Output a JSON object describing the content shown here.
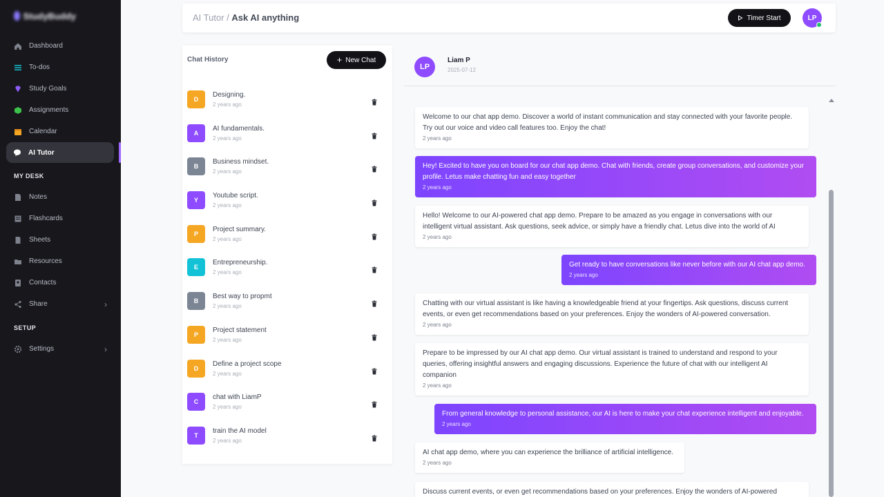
{
  "sidebar": {
    "logo_text": "StudyBuddy",
    "nav": [
      {
        "label": "Dashboard",
        "icon": "home-icon"
      },
      {
        "label": "To-dos",
        "icon": "list-icon"
      },
      {
        "label": "Study Goals",
        "icon": "diamond-icon"
      },
      {
        "label": "Assignments",
        "icon": "cube-icon"
      },
      {
        "label": "Calendar",
        "icon": "calendar-icon"
      },
      {
        "label": "AI Tutor",
        "icon": "chat-bubble-icon"
      }
    ],
    "my_desk_title": "MY DESK",
    "desk": [
      {
        "label": "Notes",
        "icon": "note-icon"
      },
      {
        "label": "Flashcards",
        "icon": "cards-icon"
      },
      {
        "label": "Sheets",
        "icon": "sheet-icon"
      },
      {
        "label": "Resources",
        "icon": "folder-icon"
      },
      {
        "label": "Contacts",
        "icon": "contacts-icon"
      },
      {
        "label": "Share",
        "icon": "share-icon"
      }
    ],
    "setup_title": "SETUP",
    "setup": [
      {
        "label": "Settings",
        "icon": "gear-icon"
      }
    ]
  },
  "header": {
    "crumb_parent": "AI Tutor",
    "crumb_sep": " / ",
    "crumb_current": "Ask AI anything",
    "timer_label": "Timer Start",
    "avatar_initials": "LP"
  },
  "history": {
    "title": "Chat History",
    "new_chat_label": "New Chat",
    "items": [
      {
        "letter": "D",
        "title": "Designing.",
        "time": "2 years ago",
        "color": "#f5a623"
      },
      {
        "letter": "A",
        "title": "AI fundamentals.",
        "time": "2 years ago",
        "color": "#8e4bff"
      },
      {
        "letter": "B",
        "title": "Business mindset.",
        "time": "2 years ago",
        "color": "#7c8594"
      },
      {
        "letter": "Y",
        "title": "Youtube script.",
        "time": "2 years ago",
        "color": "#8e4bff"
      },
      {
        "letter": "P",
        "title": "Project summary.",
        "time": "2 years ago",
        "color": "#f5a623"
      },
      {
        "letter": "E",
        "title": "Entrepreneurship.",
        "time": "2 years ago",
        "color": "#13c2d6"
      },
      {
        "letter": "B",
        "title": "Best way to propmt",
        "time": "2 years ago",
        "color": "#7c8594"
      },
      {
        "letter": "P",
        "title": "Project statement",
        "time": "2 years ago",
        "color": "#f5a623"
      },
      {
        "letter": "D",
        "title": "Define a project scope",
        "time": "2 years ago",
        "color": "#f5a623"
      },
      {
        "letter": "C",
        "title": "chat with LiamP",
        "time": "2 years ago",
        "color": "#8e4bff"
      },
      {
        "letter": "T",
        "title": "train the AI model",
        "time": "2 years ago",
        "color": "#8e4bff"
      }
    ]
  },
  "chat": {
    "user_initials": "LP",
    "user_name": "Liam P",
    "date": "2025-07-12",
    "messages": [
      {
        "dir": "in",
        "text": "Welcome to our chat app demo. Discover a world of instant communication and stay connected with your favorite people. Try out our voice and video call features too. Enjoy the chat!",
        "time": "2 years ago"
      },
      {
        "dir": "out",
        "text": "Hey! Excited to have you on board for our chat app demo. Chat with friends, create group conversations, and customize your profile. Letus make chatting fun and easy together",
        "time": "2 years ago"
      },
      {
        "dir": "in",
        "text": "Hello! Welcome to our AI-powered chat app demo. Prepare to be amazed as you engage in conversations with our intelligent virtual assistant. Ask questions, seek advice, or simply have a friendly chat. Letus dive into the world of AI",
        "time": "2 years ago"
      },
      {
        "dir": "out",
        "text": "Get ready to have conversations like never before with our AI chat app demo.",
        "time": "2 years ago"
      },
      {
        "dir": "in",
        "text": "Chatting with our virtual assistant is like having a knowledgeable friend at your fingertips. Ask questions, discuss current events, or even get recommendations based on your preferences. Enjoy the wonders of AI-powered conversation.",
        "time": "2 years ago"
      },
      {
        "dir": "in",
        "text": "Prepare to be impressed by our AI chat app demo. Our virtual assistant is trained to understand and respond to your queries, offering insightful answers and engaging discussions. Experience the future of chat with our intelligent AI companion",
        "time": "2 years ago"
      },
      {
        "dir": "out",
        "text": "From general knowledge to personal assistance, our AI is here to make your chat experience intelligent and enjoyable.",
        "time": "2 years ago"
      },
      {
        "dir": "in",
        "text": "AI chat app demo, where you can experience the brilliance of artificial intelligence.",
        "time": "2 years ago"
      },
      {
        "dir": "in",
        "text": "Discuss current events, or even get recommendations based on your preferences. Enjoy the wonders of AI-powered",
        "time": ""
      }
    ]
  },
  "colors": {
    "sidebar_bg": "#17171c",
    "accent": "#8e4bff",
    "bubble_gradient_start": "#7d45ff",
    "bubble_gradient_end": "#b04cf2",
    "online": "#22c06a"
  }
}
